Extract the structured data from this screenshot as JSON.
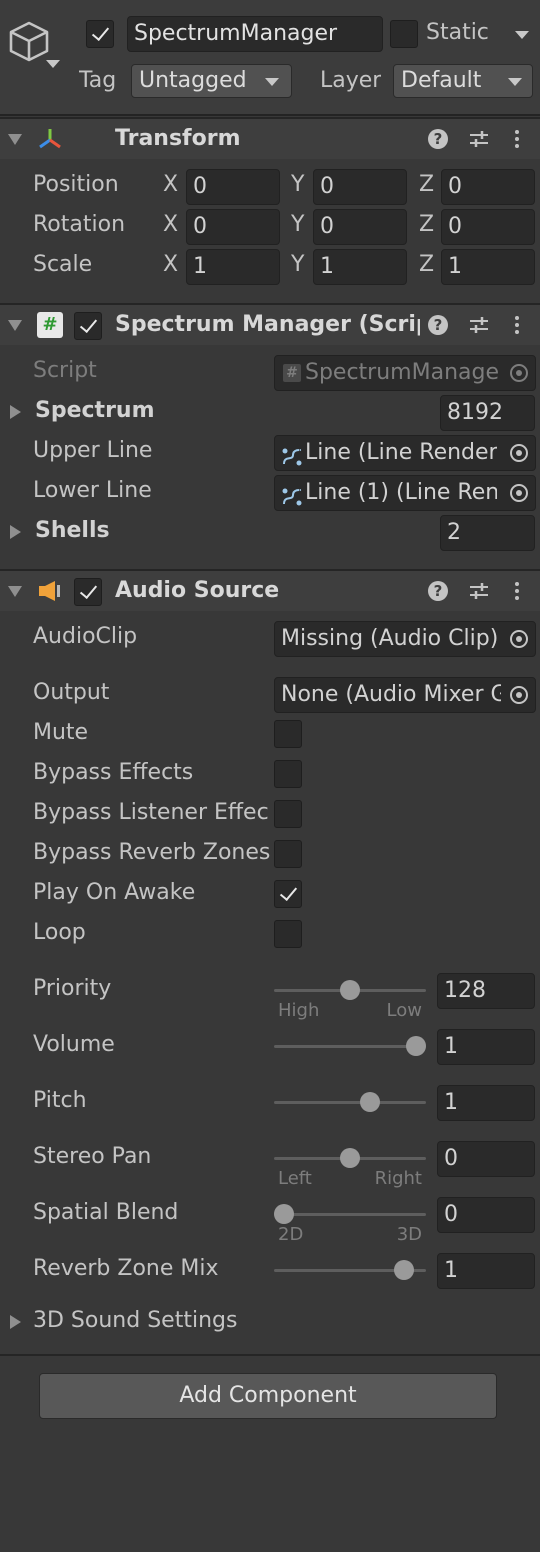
{
  "header": {
    "object_name": "SpectrumManager",
    "active": true,
    "static_label": "Static",
    "static_checked": false,
    "tag_label": "Tag",
    "tag_value": "Untagged",
    "layer_label": "Layer",
    "layer_value": "Default"
  },
  "transform": {
    "title": "Transform",
    "rows": [
      {
        "label": "Position",
        "x": "0",
        "y": "0",
        "z": "0"
      },
      {
        "label": "Rotation",
        "x": "0",
        "y": "0",
        "z": "0"
      },
      {
        "label": "Scale",
        "x": "1",
        "y": "1",
        "z": "1"
      }
    ],
    "axis": {
      "x": "X",
      "y": "Y",
      "z": "Z"
    }
  },
  "spectrum_manager": {
    "title": "Spectrum Manager (Scrip",
    "enabled": true,
    "script_label": "Script",
    "script_value": "SpectrumManage",
    "spectrum_label": "Spectrum",
    "spectrum_value": "8192",
    "upper_line_label": "Upper Line",
    "upper_line_value": "Line (Line Render",
    "lower_line_label": "Lower Line",
    "lower_line_value": "Line (1) (Line Ren",
    "shells_label": "Shells",
    "shells_value": "2"
  },
  "audio_source": {
    "title": "Audio Source",
    "enabled": true,
    "audioclip_label": "AudioClip",
    "audioclip_value": "Missing (Audio Clip)",
    "output_label": "Output",
    "output_value": "None (Audio Mixer G",
    "toggles": [
      {
        "label": "Mute",
        "checked": false
      },
      {
        "label": "Bypass Effects",
        "checked": false
      },
      {
        "label": "Bypass Listener Effec",
        "checked": false
      },
      {
        "label": "Bypass Reverb Zones",
        "checked": false
      },
      {
        "label": "Play On Awake",
        "checked": true
      },
      {
        "label": "Loop",
        "checked": false
      }
    ],
    "sliders": [
      {
        "label": "Priority",
        "value": "128",
        "fraction": 0.5,
        "min_label": "High",
        "max_label": "Low"
      },
      {
        "label": "Volume",
        "value": "1",
        "fraction": 1.0,
        "min_label": "",
        "max_label": ""
      },
      {
        "label": "Pitch",
        "value": "1",
        "fraction": 0.654,
        "min_label": "",
        "max_label": ""
      },
      {
        "label": "Stereo Pan",
        "value": "0",
        "fraction": 0.5,
        "min_label": "Left",
        "max_label": "Right"
      },
      {
        "label": "Spatial Blend",
        "value": "0",
        "fraction": 0.0,
        "min_label": "2D",
        "max_label": "3D"
      },
      {
        "label": "Reverb Zone Mix",
        "value": "1",
        "fraction": 0.909,
        "min_label": "",
        "max_label": ""
      }
    ],
    "sound_settings_label": "3D Sound Settings"
  },
  "add_component_label": "Add Component",
  "colors": {
    "background": "#383838",
    "field": "#2a2a2a",
    "text": "#c4c4c4",
    "audio_icon": "#f0a23a",
    "script_icon": "#5fb65b"
  }
}
